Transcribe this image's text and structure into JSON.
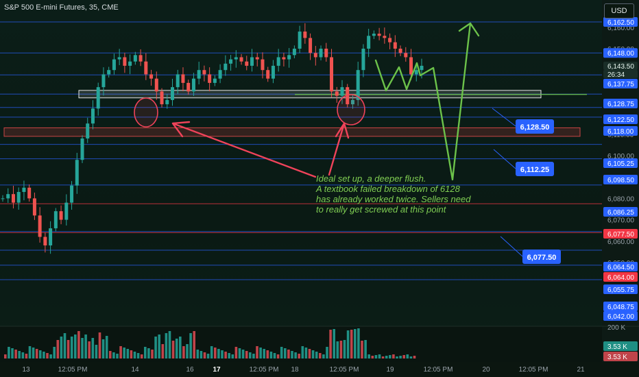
{
  "header": {
    "title": "S&P 500 E-mini Futures, 35, CME",
    "currency": "USD"
  },
  "annotation": {
    "lines": [
      "Ideal set up, a deeper flush.",
      "A textbook failed breakdown of 6128",
      "has already worked twice. Sellers need",
      "to really get screwed at this point"
    ]
  },
  "colors": {
    "up": "#26a69a",
    "down": "#ef5350",
    "level_line": "#2962ff",
    "tag_blue": "#2962ff",
    "tag_red": "#f23645",
    "arrow_green": "#6cc24a",
    "arrow_red": "#f0435a"
  },
  "chart_data": {
    "type": "candlestick",
    "symbol": "S&P 500 E-mini Futures",
    "interval": "35",
    "exchange": "CME",
    "ylim": [
      6040,
      6163
    ],
    "y_ticks": [
      "6,160.00",
      "6,150.00",
      "6,110.00",
      "6,100.00",
      "6,090.00",
      "6,080.00",
      "6,070.00",
      "6,060.00",
      "6,050.00"
    ],
    "x_ticks": [
      "13",
      "12:05 PM",
      "14",
      "16",
      "17",
      "12:05 PM",
      "18",
      "12:05 PM",
      "19",
      "12:05 PM",
      "20",
      "12:05 PM",
      "21"
    ],
    "price_levels": [
      6162.5,
      6148.0,
      6137.75,
      6128.75,
      6122.5,
      6118.0,
      6105.25,
      6098.5,
      6086.25,
      6077.5,
      6064.5,
      6064.0,
      6055.75,
      6048.75,
      6042.0
    ],
    "price_labels": [
      "6,162.50",
      "6,148.00",
      "6,143.50",
      "26:34",
      "6,137.75",
      "6,128.75",
      "6,122.50",
      "6,118.00",
      "6,105.25",
      "6,098.50",
      "6,086.25",
      "6,077.50",
      "6,064.50",
      "6,064.00",
      "6,055.75",
      "6,048.75",
      "6,042.00"
    ],
    "current_price": 6143.5,
    "countdown": "26:34",
    "callouts": [
      "6,128.50",
      "6,112.25",
      "6,077.50"
    ],
    "zones": [
      {
        "from": 6127.0,
        "to": 6130.5,
        "type": "support"
      },
      {
        "from": 6109.0,
        "to": 6113.0,
        "type": "demand"
      }
    ],
    "volume_labels": [
      "200 K",
      "3.53 K",
      "3.53 K"
    ],
    "close_path": [
      6080,
      6082,
      6078,
      6083,
      6085,
      6080,
      6072,
      6062,
      6058,
      6066,
      6074,
      6070,
      6078,
      6086,
      6098,
      6108,
      6115,
      6122,
      6132,
      6138,
      6140,
      6145,
      6146,
      6142,
      6144,
      6147,
      6144,
      6138,
      6136,
      6130,
      6124,
      6126,
      6132,
      6138,
      6134,
      6130,
      6136,
      6140,
      6138,
      6134,
      6136,
      6140,
      6143,
      6145,
      6146,
      6144,
      6142,
      6146,
      6145,
      6140,
      6136,
      6142,
      6146,
      6145,
      6147,
      6150,
      6158,
      6155,
      6148,
      6146,
      6150,
      6146,
      6130,
      6128,
      6132,
      6124,
      6126,
      6140,
      6150,
      6156,
      6157,
      6156,
      6155,
      6153,
      6150,
      6148,
      6146,
      6138,
      6140,
      6142
    ]
  }
}
